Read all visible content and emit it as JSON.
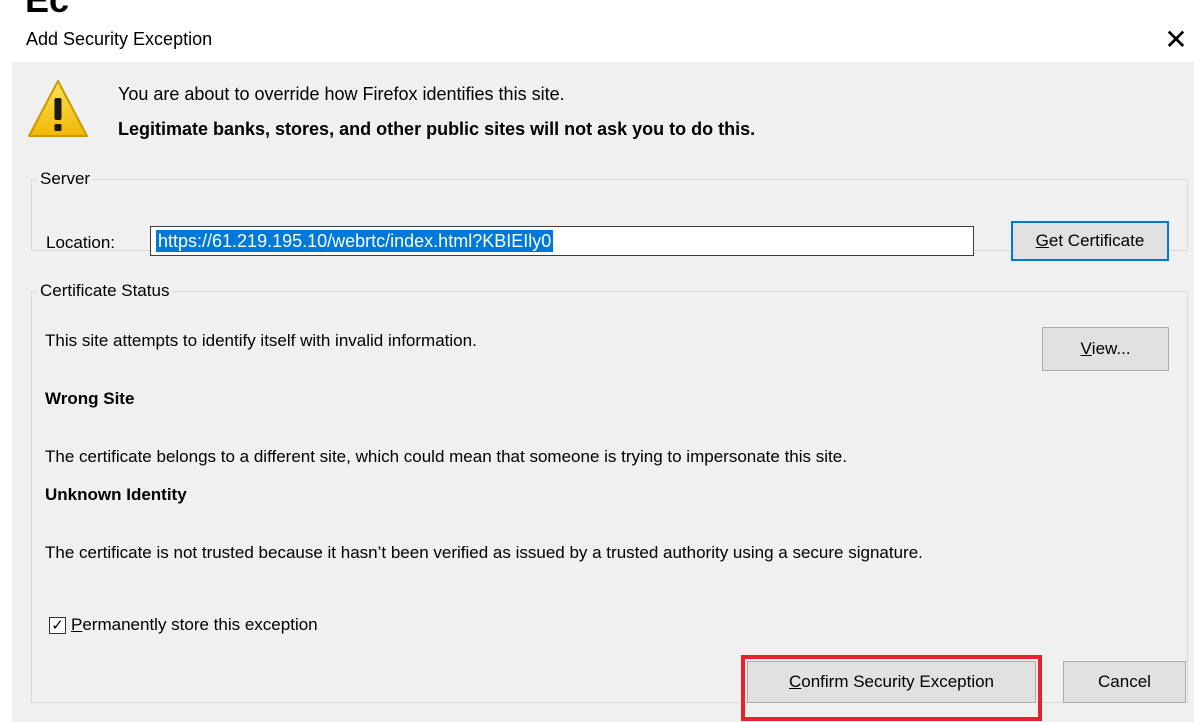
{
  "window": {
    "title": "Add Security Exception",
    "close_glyph": "✕"
  },
  "warning": {
    "line1": "You are about to override how Firefox identifies this site.",
    "line2": "Legitimate banks, stores, and other public sites will not ask you to do this."
  },
  "server": {
    "legend": "Server",
    "location_label": "Location:",
    "location_value": "https://61.219.195.10/webrtc/index.html?KBIEIly0",
    "get_certificate_accesskey": "G",
    "get_certificate_rest": "et Certificate"
  },
  "certificate_status": {
    "legend": "Certificate Status",
    "intro": "This site attempts to identify itself with invalid information.",
    "view_accesskey": "V",
    "view_rest": "iew...",
    "wrong_site_heading": "Wrong Site",
    "wrong_site_desc": "The certificate belongs to a different site, which could mean that someone is trying to impersonate this site.",
    "unknown_identity_heading": "Unknown Identity",
    "unknown_identity_desc": "The certificate is not trusted because it hasn’t been verified as issued by a trusted authority using a secure signature.",
    "permanent_store_checked": true,
    "checkbox_glyph": "✓",
    "permanent_store_accesskey": "P",
    "permanent_store_rest": "ermanently store this exception"
  },
  "footer": {
    "confirm_accesskey": "C",
    "confirm_rest": "onfirm Security Exception",
    "cancel_label": "Cancel",
    "highlight_color": "#e8222f"
  },
  "colors": {
    "selection": "#0078d7",
    "dialog_bg": "#f0f0f0",
    "warning_yellow": "#f6cc25"
  },
  "icons": [
    "warning-icon",
    "close-icon",
    "checkbox-check-icon"
  ]
}
